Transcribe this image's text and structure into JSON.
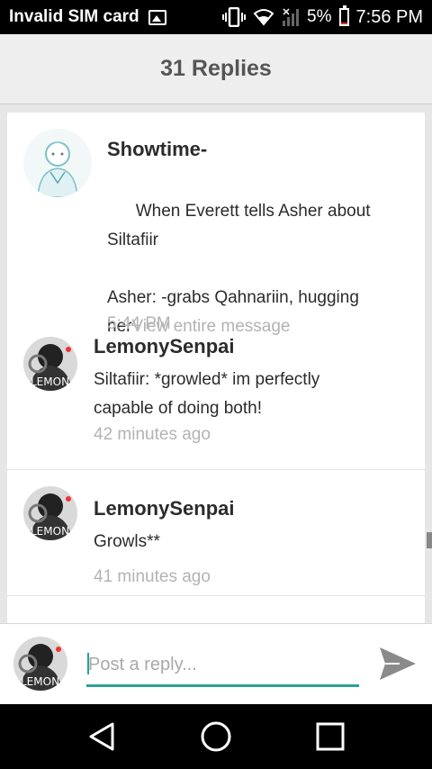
{
  "status_bar": {
    "carrier": "Invalid SIM card",
    "battery": "5%",
    "time": "7:56 PM",
    "icons": [
      "image-icon",
      "vibrate-icon",
      "wifi-icon",
      "signal-icon",
      "battery-icon"
    ],
    "battery_level": 0.05
  },
  "header": {
    "title": "31 Replies"
  },
  "parent_message": {
    "username": "Showtime-",
    "text": "When Everett tells Asher about Siltafiir\n\nAsher: -grabs Qahnariin, hugging her",
    "view_more": "View entire message",
    "time": "5:44 PM"
  },
  "replies": [
    {
      "username": "LemonySenpai",
      "text": "Siltafiir: *growled* im perfectly capable of doing both!",
      "time": "42 minutes ago"
    },
    {
      "username": "LemonySenpai",
      "text": "Growls**",
      "time": "41 minutes ago"
    }
  ],
  "composer": {
    "placeholder": "Post a reply...",
    "value": ""
  },
  "nav": {
    "icons": [
      "back-icon",
      "home-icon",
      "recents-icon"
    ]
  },
  "colors": {
    "accent": "#2aa198",
    "status_bar_bg": "#000000",
    "header_bg": "#eeeeee",
    "battery_low": "#d9352b"
  }
}
